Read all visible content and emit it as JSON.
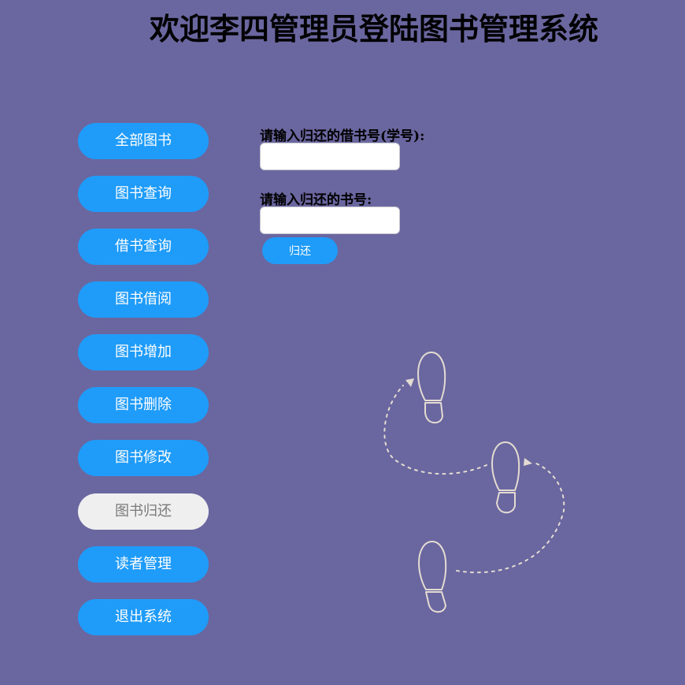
{
  "header": {
    "title": "欢迎李四管理员登陆图书管理系统"
  },
  "sidebar": {
    "items": [
      {
        "label": "全部图书",
        "active": false
      },
      {
        "label": "图书查询",
        "active": false
      },
      {
        "label": "借书查询",
        "active": false
      },
      {
        "label": "图书借阅",
        "active": false
      },
      {
        "label": "图书增加",
        "active": false
      },
      {
        "label": "图书删除",
        "active": false
      },
      {
        "label": "图书修改",
        "active": false
      },
      {
        "label": "图书归还",
        "active": true
      },
      {
        "label": "读者管理",
        "active": false
      },
      {
        "label": "退出系统",
        "active": false
      }
    ]
  },
  "form": {
    "borrow_id_label": "请输入归还的借书号(学号):",
    "borrow_id_value": "",
    "book_id_label": "请输入归还的书号:",
    "book_id_value": "",
    "submit_label": "归还"
  },
  "colors": {
    "background": "#6a67a0",
    "accent": "#1f9bfa",
    "active_item": "#efefef"
  },
  "decoration": {
    "icon": "footprints-icon"
  }
}
